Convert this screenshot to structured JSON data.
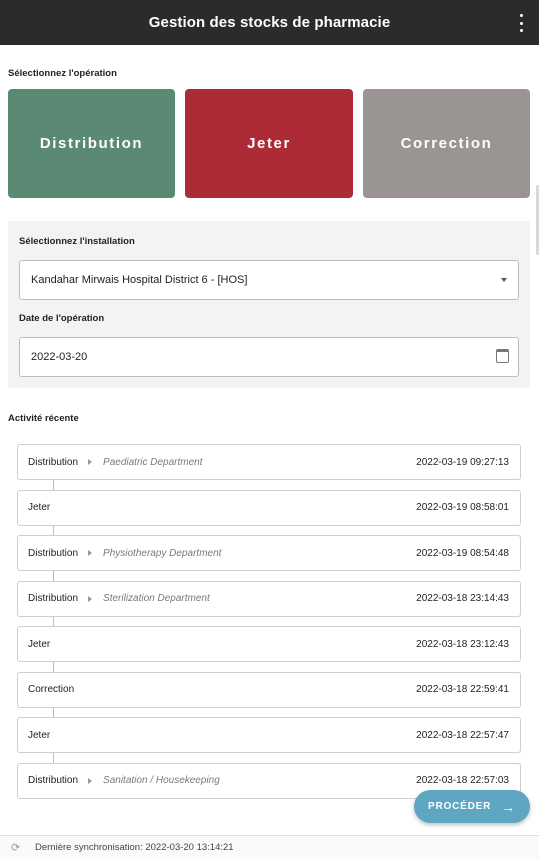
{
  "app": {
    "title": "Gestion des stocks de pharmacie",
    "menu_icon": "more-vertical-icon"
  },
  "operation": {
    "label": "Sélectionnez l'opération",
    "options": [
      {
        "label": "Distribution",
        "color": "#5a8a73"
      },
      {
        "label": "Jeter",
        "color": "#ad2b37"
      },
      {
        "label": "Correction",
        "color": "#9a9592"
      }
    ]
  },
  "facility": {
    "label": "Sélectionnez l'installation",
    "value": "Kandahar Mirwais Hospital District 6 -  [HOS]"
  },
  "date": {
    "label": "Date de l'opération",
    "value": "2022-03-20"
  },
  "recent": {
    "label": "Activité récente",
    "items": [
      {
        "type": "Distribution",
        "dept": "Paediatric Department",
        "ts": "2022-03-19 09:27:13"
      },
      {
        "type": "Jeter",
        "dept": "",
        "ts": "2022-03-19 08:58:01"
      },
      {
        "type": "Distribution",
        "dept": "Physiotherapy Department",
        "ts": "2022-03-19 08:54:48"
      },
      {
        "type": "Distribution",
        "dept": "Sterilization Department",
        "ts": "2022-03-18 23:14:43"
      },
      {
        "type": "Jeter",
        "dept": "",
        "ts": "2022-03-18 23:12:43"
      },
      {
        "type": "Correction",
        "dept": "",
        "ts": "2022-03-18 22:59:41"
      },
      {
        "type": "Jeter",
        "dept": "",
        "ts": "2022-03-18 22:57:47"
      },
      {
        "type": "Distribution",
        "dept": "Sanitation / Housekeeping",
        "ts": "2022-03-18 22:57:03"
      }
    ]
  },
  "proceed": {
    "label": "PROCÉDER"
  },
  "footer": {
    "sync_text": "Dernière synchronisation:  2022-03-20 13:14:21"
  }
}
